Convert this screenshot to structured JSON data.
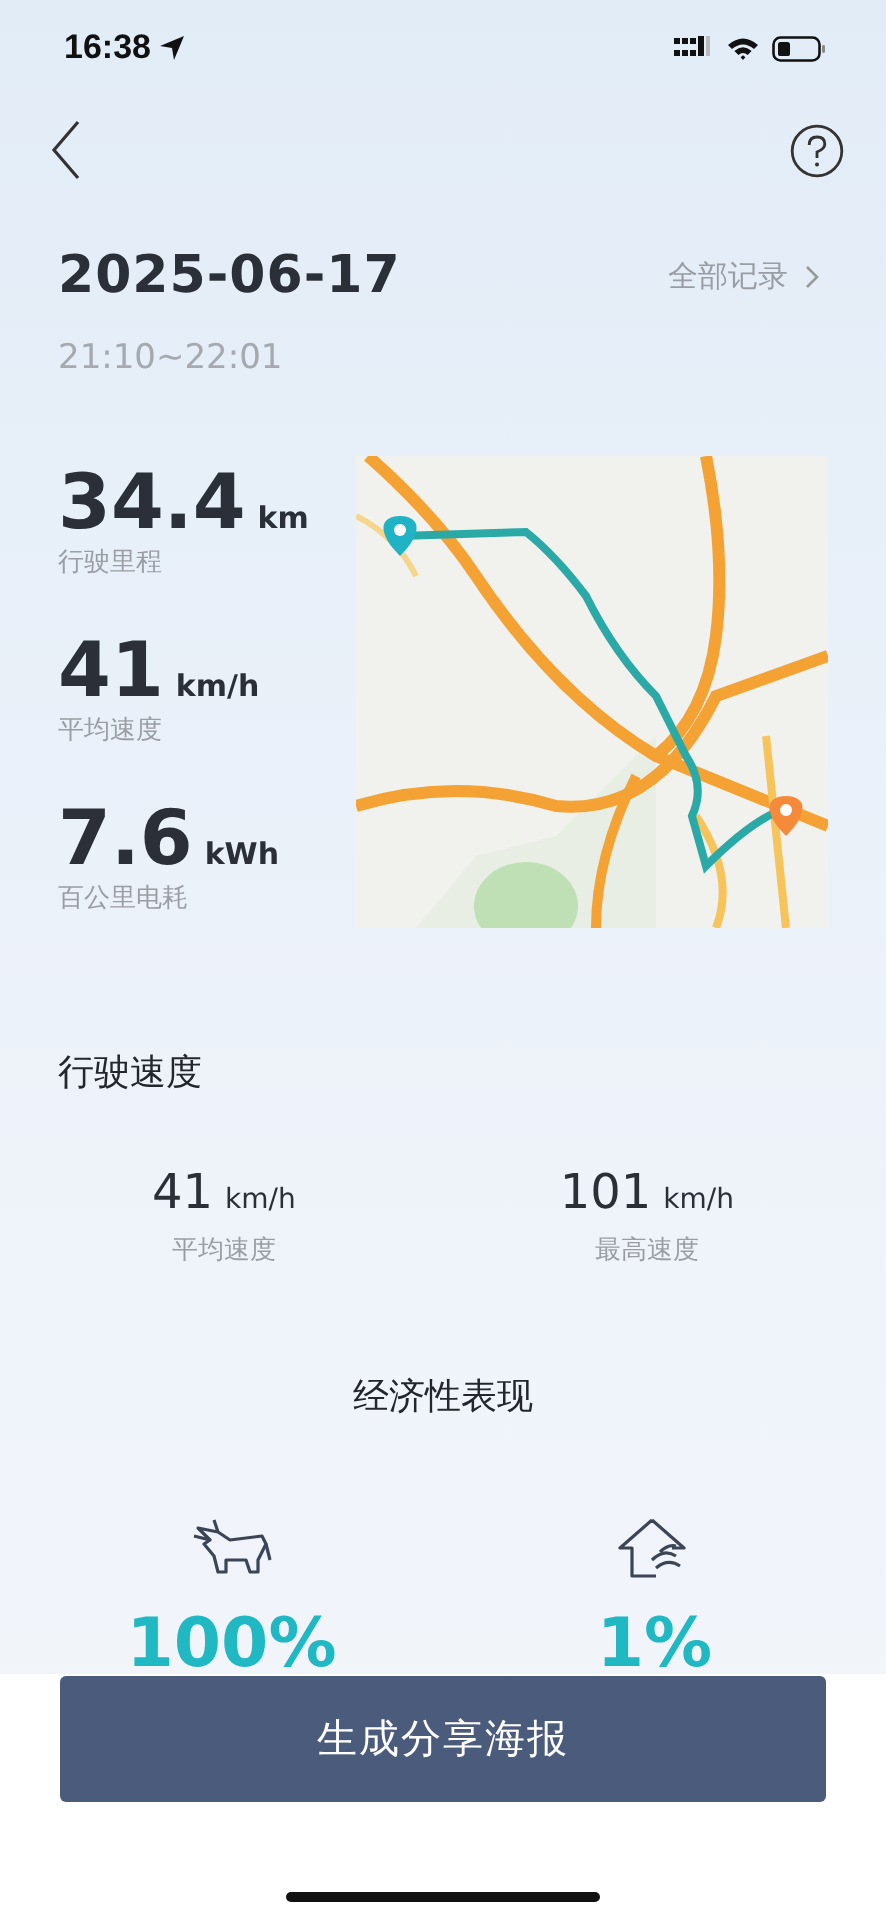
{
  "status_bar": {
    "time": "16:38"
  },
  "trip": {
    "date": "2025-06-17",
    "time_range": "21:10~22:01",
    "all_records": "全部记录"
  },
  "stats": [
    {
      "value": "34.4",
      "unit": "km",
      "label": "行驶里程"
    },
    {
      "value": "41",
      "unit": "km/h",
      "label": "平均速度"
    },
    {
      "value": "7.6",
      "unit": "kWh",
      "label": "百公里电耗"
    }
  ],
  "speed": {
    "title": "行驶速度",
    "items": [
      {
        "value": "41",
        "unit": "km/h",
        "label": "平均速度"
      },
      {
        "value": "101",
        "unit": "km/h",
        "label": "最高速度"
      }
    ]
  },
  "economy": {
    "title": "经济性表现",
    "items": [
      {
        "kind": "bull",
        "value": "100%"
      },
      {
        "kind": "house",
        "value": "1%"
      }
    ]
  },
  "share_button": {
    "label": "生成分享海报"
  }
}
